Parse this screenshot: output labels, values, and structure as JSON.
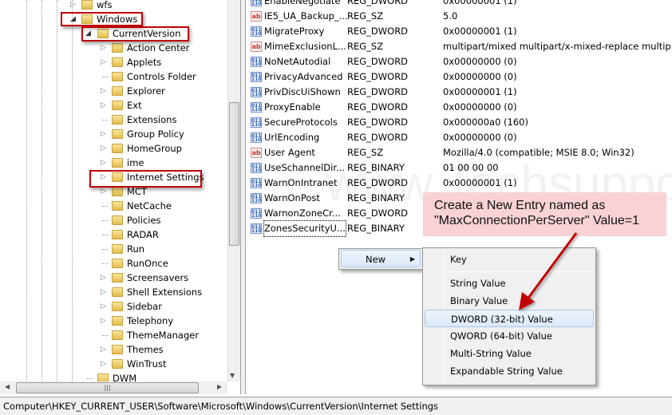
{
  "tree": {
    "items": [
      {
        "label": "wfs",
        "level": 0,
        "expander": "collapsed"
      },
      {
        "label": "Windows",
        "level": 0,
        "expander": "expanded",
        "highlighted": true
      },
      {
        "label": "CurrentVersion",
        "level": 1,
        "expander": "expanded",
        "highlighted": true
      },
      {
        "label": "Action Center",
        "level": 2,
        "expander": "collapsed"
      },
      {
        "label": "Applets",
        "level": 2,
        "expander": "collapsed"
      },
      {
        "label": "Controls Folder",
        "level": 2,
        "expander": "none"
      },
      {
        "label": "Explorer",
        "level": 2,
        "expander": "collapsed"
      },
      {
        "label": "Ext",
        "level": 2,
        "expander": "collapsed"
      },
      {
        "label": "Extensions",
        "level": 2,
        "expander": "none"
      },
      {
        "label": "Group Policy",
        "level": 2,
        "expander": "collapsed"
      },
      {
        "label": "HomeGroup",
        "level": 2,
        "expander": "collapsed"
      },
      {
        "label": "ime",
        "level": 2,
        "expander": "collapsed"
      },
      {
        "label": "Internet Settings",
        "level": 2,
        "expander": "collapsed",
        "highlighted": true,
        "selected": true
      },
      {
        "label": "MCT",
        "level": 2,
        "expander": "collapsed"
      },
      {
        "label": "NetCache",
        "level": 2,
        "expander": "none"
      },
      {
        "label": "Policies",
        "level": 2,
        "expander": "none"
      },
      {
        "label": "RADAR",
        "level": 2,
        "expander": "none"
      },
      {
        "label": "Run",
        "level": 2,
        "expander": "none"
      },
      {
        "label": "RunOnce",
        "level": 2,
        "expander": "none"
      },
      {
        "label": "Screensavers",
        "level": 2,
        "expander": "collapsed"
      },
      {
        "label": "Shell Extensions",
        "level": 2,
        "expander": "collapsed"
      },
      {
        "label": "Sidebar",
        "level": 2,
        "expander": "collapsed"
      },
      {
        "label": "Telephony",
        "level": 2,
        "expander": "collapsed"
      },
      {
        "label": "ThemeManager",
        "level": 2,
        "expander": "none"
      },
      {
        "label": "Themes",
        "level": 2,
        "expander": "collapsed"
      },
      {
        "label": "WinTrust",
        "level": 2,
        "expander": "collapsed"
      },
      {
        "label": "DWM",
        "level": 1,
        "expander": "none"
      }
    ]
  },
  "values": [
    {
      "name": "EnableNegotiate",
      "type": "REG_DWORD",
      "data": "0x00000001 (1)",
      "icon": "binary"
    },
    {
      "name": "IE5_UA_Backup_...",
      "type": "REG_SZ",
      "data": "5.0",
      "icon": "string"
    },
    {
      "name": "MigrateProxy",
      "type": "REG_DWORD",
      "data": "0x00000001 (1)",
      "icon": "binary"
    },
    {
      "name": "MimeExclusionL...",
      "type": "REG_SZ",
      "data": "multipart/mixed multipart/x-mixed-replace multip...",
      "icon": "string"
    },
    {
      "name": "NoNetAutodial",
      "type": "REG_DWORD",
      "data": "0x00000000 (0)",
      "icon": "binary"
    },
    {
      "name": "PrivacyAdvanced",
      "type": "REG_DWORD",
      "data": "0x00000000 (0)",
      "icon": "binary"
    },
    {
      "name": "PrivDiscUiShown",
      "type": "REG_DWORD",
      "data": "0x00000001 (1)",
      "icon": "binary"
    },
    {
      "name": "ProxyEnable",
      "type": "REG_DWORD",
      "data": "0x00000000 (0)",
      "icon": "binary"
    },
    {
      "name": "SecureProtocols",
      "type": "REG_DWORD",
      "data": "0x000000a0 (160)",
      "icon": "binary"
    },
    {
      "name": "UrlEncoding",
      "type": "REG_DWORD",
      "data": "0x00000000 (0)",
      "icon": "binary"
    },
    {
      "name": "User Agent",
      "type": "REG_SZ",
      "data": "Mozilla/4.0 (compatible; MSIE 8.0; Win32)",
      "icon": "string"
    },
    {
      "name": "UseSchannelDir...",
      "type": "REG_BINARY",
      "data": "01 00 00 00",
      "icon": "binary"
    },
    {
      "name": "WarnOnIntranet",
      "type": "REG_DWORD",
      "data": "0x00000001 (1)",
      "icon": "binary"
    },
    {
      "name": "WarnOnPost",
      "type": "REG_BINARY",
      "data": "",
      "icon": "binary"
    },
    {
      "name": "WarnonZoneCr...",
      "type": "REG_DWORD",
      "data": "",
      "icon": "binary"
    },
    {
      "name": "ZonesSecurityU...",
      "type": "REG_BINARY",
      "data": "",
      "icon": "binary",
      "focused": true
    }
  ],
  "context_menu": {
    "new_label": "New",
    "arrow": "▶"
  },
  "submenu": {
    "items": [
      "Key",
      "String Value",
      "Binary Value",
      "DWORD (32-bit) Value",
      "QWORD (64-bit) Value",
      "Multi-String Value",
      "Expandable String Value"
    ],
    "highlighted": "DWORD (32-bit) Value"
  },
  "annotation": {
    "line1": "Create a New Entry named as",
    "line2": "\"MaxConnectionPerServer\" Value=1",
    "color": "#c00000",
    "background": "#f8d2d5"
  },
  "watermark": "www.Techsupportall.com",
  "status_bar": {
    "path": "Computer\\HKEY_CURRENT_USER\\Software\\Microsoft\\Windows\\CurrentVersion\\Internet Settings"
  },
  "icons": {
    "folder": "folder-icon",
    "binary": "registry-binary-icon",
    "string": "registry-string-icon",
    "scroll_left": "◀",
    "scroll_right": "▶",
    "scroll_down": "▼",
    "grip": "|||"
  }
}
